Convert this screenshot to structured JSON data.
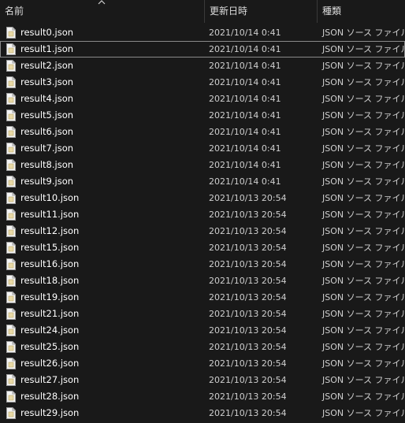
{
  "columns": {
    "name": "名前",
    "date": "更新日時",
    "type": "種類"
  },
  "sort": {
    "column": "name",
    "direction": "ascending",
    "icon": "chevron-up-icon"
  },
  "colors": {
    "background": "#191919",
    "focus_border": "#8a8a8a",
    "file_icon": "#e8d9a6"
  },
  "files": [
    {
      "name": "result0.json",
      "date": "2021/10/14 0:41",
      "type": "JSON ソース ファイル",
      "focused": false
    },
    {
      "name": "result1.json",
      "date": "2021/10/14 0:41",
      "type": "JSON ソース ファイル",
      "focused": true
    },
    {
      "name": "result2.json",
      "date": "2021/10/14 0:41",
      "type": "JSON ソース ファイル",
      "focused": false
    },
    {
      "name": "result3.json",
      "date": "2021/10/14 0:41",
      "type": "JSON ソース ファイル",
      "focused": false
    },
    {
      "name": "result4.json",
      "date": "2021/10/14 0:41",
      "type": "JSON ソース ファイル",
      "focused": false
    },
    {
      "name": "result5.json",
      "date": "2021/10/14 0:41",
      "type": "JSON ソース ファイル",
      "focused": false
    },
    {
      "name": "result6.json",
      "date": "2021/10/14 0:41",
      "type": "JSON ソース ファイル",
      "focused": false
    },
    {
      "name": "result7.json",
      "date": "2021/10/14 0:41",
      "type": "JSON ソース ファイル",
      "focused": false
    },
    {
      "name": "result8.json",
      "date": "2021/10/14 0:41",
      "type": "JSON ソース ファイル",
      "focused": false
    },
    {
      "name": "result9.json",
      "date": "2021/10/14 0:41",
      "type": "JSON ソース ファイル",
      "focused": false
    },
    {
      "name": "result10.json",
      "date": "2021/10/13 20:54",
      "type": "JSON ソース ファイル",
      "focused": false
    },
    {
      "name": "result11.json",
      "date": "2021/10/13 20:54",
      "type": "JSON ソース ファイル",
      "focused": false
    },
    {
      "name": "result12.json",
      "date": "2021/10/13 20:54",
      "type": "JSON ソース ファイル",
      "focused": false
    },
    {
      "name": "result15.json",
      "date": "2021/10/13 20:54",
      "type": "JSON ソース ファイル",
      "focused": false
    },
    {
      "name": "result16.json",
      "date": "2021/10/13 20:54",
      "type": "JSON ソース ファイル",
      "focused": false
    },
    {
      "name": "result18.json",
      "date": "2021/10/13 20:54",
      "type": "JSON ソース ファイル",
      "focused": false
    },
    {
      "name": "result19.json",
      "date": "2021/10/13 20:54",
      "type": "JSON ソース ファイル",
      "focused": false
    },
    {
      "name": "result21.json",
      "date": "2021/10/13 20:54",
      "type": "JSON ソース ファイル",
      "focused": false
    },
    {
      "name": "result24.json",
      "date": "2021/10/13 20:54",
      "type": "JSON ソース ファイル",
      "focused": false
    },
    {
      "name": "result25.json",
      "date": "2021/10/13 20:54",
      "type": "JSON ソース ファイル",
      "focused": false
    },
    {
      "name": "result26.json",
      "date": "2021/10/13 20:54",
      "type": "JSON ソース ファイル",
      "focused": false
    },
    {
      "name": "result27.json",
      "date": "2021/10/13 20:54",
      "type": "JSON ソース ファイル",
      "focused": false
    },
    {
      "name": "result28.json",
      "date": "2021/10/13 20:54",
      "type": "JSON ソース ファイル",
      "focused": false
    },
    {
      "name": "result29.json",
      "date": "2021/10/13 20:54",
      "type": "JSON ソース ファイル",
      "focused": false
    }
  ]
}
